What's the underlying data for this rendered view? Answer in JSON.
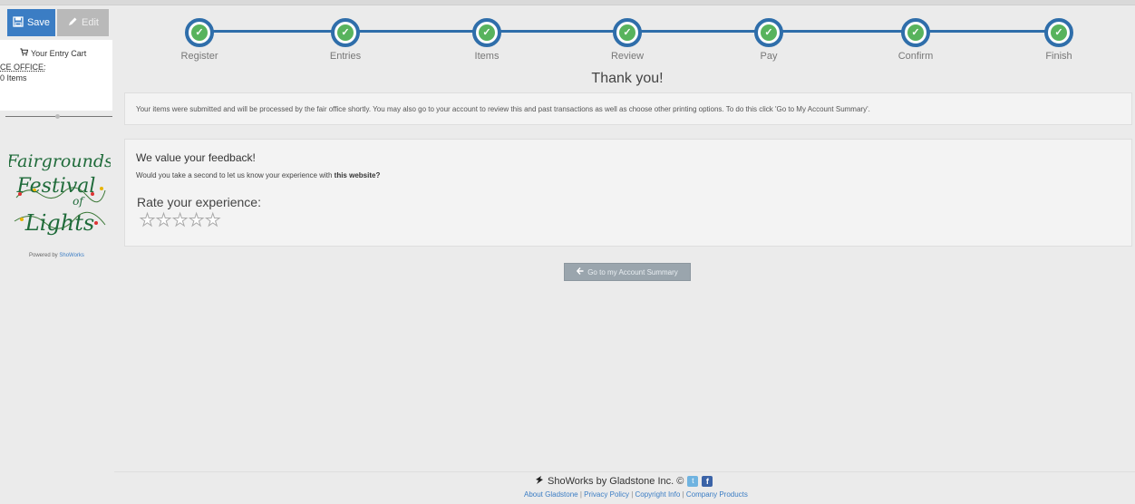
{
  "sidebar": {
    "save_label": "Save",
    "edit_label": "Edit",
    "cart_title": "Your Entry Cart",
    "office_label": "CE OFFICE:",
    "items_label": "0 Items",
    "logo_text": [
      "Fairgrounds",
      "Festival",
      "of",
      "Lights"
    ],
    "powered_prefix": "Powered by",
    "powered_link": "ShoWorks"
  },
  "steps": [
    {
      "label": "Register",
      "icon": "check-icon"
    },
    {
      "label": "Entries",
      "icon": "check-icon"
    },
    {
      "label": "Items",
      "icon": "check-icon"
    },
    {
      "label": "Review",
      "icon": "check-icon"
    },
    {
      "label": "Pay",
      "icon": "check-icon"
    },
    {
      "label": "Confirm",
      "icon": "check-icon"
    },
    {
      "label": "Finish",
      "icon": "check-icon"
    }
  ],
  "main": {
    "title": "Thank you!",
    "info": "Your items were submitted and will be processed by the fair office shortly. You may also go to your account to review this and past transactions as well as choose other printing options. To do this click 'Go to My Account Summary'.",
    "feedback": {
      "title": "We value your feedback!",
      "question_prefix": "Would you take a second to let us know your experience with",
      "question_bold": "this website?",
      "rate_label": "Rate your experience:",
      "stars_total": 5,
      "stars_filled": 0
    },
    "account_button": "Go to my Account Summary"
  },
  "footer": {
    "brand": "ShoWorks by Gladstone Inc. ©",
    "links": [
      "About Gladstone",
      "Privacy Policy",
      "Copyright Info",
      "Company Products"
    ]
  },
  "colors": {
    "accent": "#2f6eaa",
    "check": "#58b35d",
    "save": "#3b7dc4"
  }
}
